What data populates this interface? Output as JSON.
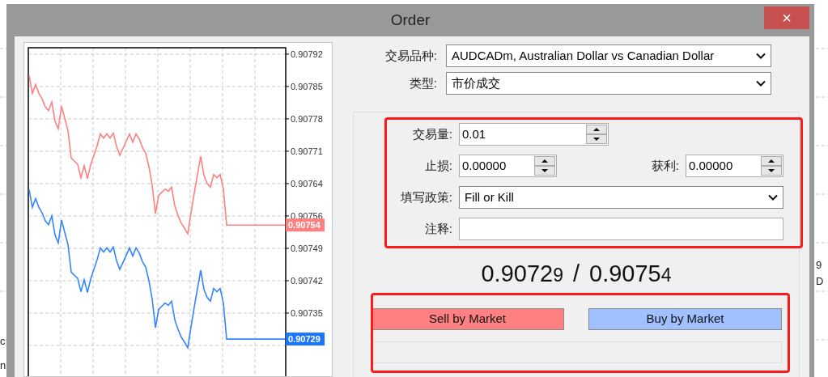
{
  "background_chart": {
    "fragments": [
      "c",
      "n",
      "9 D"
    ]
  },
  "window": {
    "title": "Order",
    "close": "×"
  },
  "chart": {
    "chart_data": {
      "type": "line",
      "categories": [
        null,
        null,
        null,
        null,
        null,
        null,
        null,
        null,
        null,
        null,
        null,
        null,
        null,
        null,
        null,
        null,
        null,
        null,
        null,
        null,
        null,
        null,
        null,
        null,
        null,
        null,
        null,
        null,
        null,
        null,
        null,
        null,
        null,
        null,
        null,
        null,
        null,
        null,
        null,
        null,
        null,
        null,
        null,
        null,
        null,
        null,
        null,
        null,
        null,
        null,
        null,
        null,
        null,
        null,
        null,
        null,
        null,
        null,
        null,
        null,
        null,
        null,
        null,
        null,
        null,
        null,
        null,
        null,
        null,
        null,
        null,
        null,
        null,
        null,
        null,
        null,
        null,
        null,
        null,
        null
      ],
      "series": [
        {
          "color": "#ff8080",
          "values": [
            0.907873,
            0.907834,
            0.907853,
            0.907834,
            0.907822,
            0.907804,
            0.907796,
            0.907815,
            0.907773,
            0.907756,
            0.907806,
            0.907779,
            0.907752,
            0.907692,
            0.907685,
            0.907678,
            0.907649,
            0.907675,
            0.907647,
            0.907677,
            0.907698,
            0.907719,
            0.907745,
            0.907736,
            0.907745,
            0.907736,
            0.907747,
            0.907717,
            0.907698,
            0.907713,
            0.907729,
            0.907745,
            0.907727,
            0.907745,
            0.907734,
            0.907715,
            0.907703,
            0.907673,
            0.907633,
            0.90757,
            0.90761,
            0.907617,
            0.907624,
            0.907619,
            0.907628,
            0.907587,
            0.907566,
            0.907549,
            0.907538,
            0.907526,
            0.907572,
            0.907615,
            0.907656,
            0.907696,
            0.907654,
            0.907636,
            0.907628,
            0.907656,
            0.907649,
            0.907656,
            0.907624,
            0.907545,
            0.907545,
            0.907545,
            0.907545,
            0.907545,
            0.907545,
            0.907545,
            0.907545,
            0.907545,
            0.907545,
            0.907545,
            0.907545,
            0.907545,
            0.907545,
            0.907545,
            0.907545,
            0.907545,
            0.907545,
            0.907545
          ]
        },
        {
          "color": "#3385ff",
          "values": [
            0.907623,
            0.907584,
            0.907603,
            0.907584,
            0.907572,
            0.907554,
            0.907546,
            0.907565,
            0.907523,
            0.907506,
            0.907556,
            0.907529,
            0.907502,
            0.907442,
            0.907435,
            0.907428,
            0.907399,
            0.907425,
            0.907397,
            0.907427,
            0.907448,
            0.907469,
            0.907495,
            0.907486,
            0.907495,
            0.907486,
            0.907497,
            0.907467,
            0.907448,
            0.907463,
            0.907479,
            0.907495,
            0.907477,
            0.907495,
            0.907484,
            0.907465,
            0.907453,
            0.907423,
            0.907383,
            0.90732,
            0.90736,
            0.907367,
            0.907374,
            0.907369,
            0.907378,
            0.907337,
            0.907316,
            0.907299,
            0.907288,
            0.907276,
            0.907322,
            0.907365,
            0.907406,
            0.907446,
            0.907404,
            0.907386,
            0.907378,
            0.907406,
            0.907399,
            0.907406,
            0.907374,
            0.907295,
            0.907295,
            0.907295,
            0.907295,
            0.907295,
            0.907295,
            0.907295,
            0.907295,
            0.907295,
            0.907295,
            0.907295,
            0.907295,
            0.907295,
            0.907295,
            0.907295,
            0.907295,
            0.907295,
            0.907295,
            0.907295
          ]
        }
      ],
      "ylim": [
        0.90721,
        0.907934
      ],
      "grid": true,
      "yticks": [
        {
          "value": 0.90792,
          "label": "0.90792"
        },
        {
          "value": 0.907849,
          "label": "0.90785"
        },
        {
          "value": 0.907778,
          "label": "0.90778"
        },
        {
          "value": 0.907707,
          "label": "0.90771"
        },
        {
          "value": 0.907636,
          "label": "0.90764"
        },
        {
          "value": 0.907565,
          "label": "0.90756"
        },
        {
          "value": 0.907494,
          "label": "0.90749"
        },
        {
          "value": 0.907423,
          "label": "0.90742"
        },
        {
          "value": 0.907352,
          "label": "0.90735"
        }
      ]
    },
    "price_tags": [
      {
        "text": "0.90754",
        "color": "#ff8080"
      },
      {
        "text": "0.90729",
        "color": "#1a75ff"
      }
    ]
  },
  "symbol": {
    "label": "交易品种:",
    "value": "AUDCADm, Australian Dollar vs Canadian Dollar"
  },
  "type": {
    "label": "类型:",
    "value": "市价成交"
  },
  "volume": {
    "label": "交易量:",
    "value": "0.01"
  },
  "stop_loss": {
    "label": "止损:",
    "value": "0.00000"
  },
  "take_profit": {
    "label": "获利:",
    "value": "0.00000"
  },
  "fill_policy": {
    "label": "填写政策:",
    "value": "Fill or Kill"
  },
  "comment": {
    "label": "注释:"
  },
  "quote": {
    "bid": {
      "main": "0.9072",
      "last": "9"
    },
    "separator": "/",
    "ask": {
      "main": "0.9075",
      "last": "4"
    }
  },
  "buttons": [
    {
      "kind": "sell",
      "label": "Sell by Market"
    },
    {
      "kind": "buy",
      "label": "Buy by Market"
    }
  ]
}
